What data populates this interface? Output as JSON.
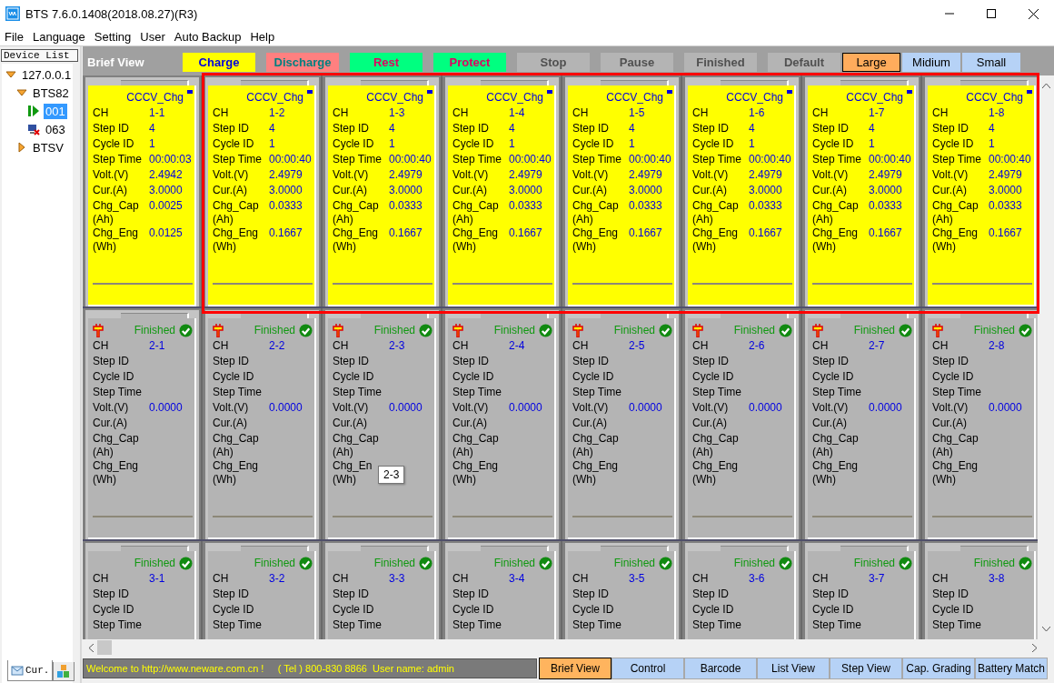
{
  "window": {
    "title": "BTS 7.6.0.1408(2018.08.27)(R3)"
  },
  "menu": [
    "File",
    "Language",
    "Setting",
    "User",
    "Auto Backup",
    "Help"
  ],
  "device_list": {
    "title": "Device List",
    "tree": [
      {
        "label": "127.0.0.1",
        "expanded": true,
        "children": [
          {
            "label": "BTS82",
            "expanded": true,
            "children": [
              {
                "label": "001",
                "kind": "running",
                "selected": true
              },
              {
                "label": "063",
                "kind": "offline",
                "selected": false
              }
            ]
          },
          {
            "label": "BTSV",
            "expanded": false
          }
        ]
      }
    ],
    "tabs": [
      {
        "label": "Cur.",
        "selected": true
      },
      {
        "selected": false
      }
    ]
  },
  "view_title": "Brief View",
  "legend": [
    {
      "label": "Charge",
      "kind": "charge",
      "color": "#ffff00"
    },
    {
      "label": "Discharge",
      "kind": "discharge",
      "color": "#ff8080"
    },
    {
      "label": "Rest",
      "kind": "rest",
      "color": "#00ff80"
    },
    {
      "label": "Protect",
      "kind": "protect",
      "color": "#00ff80"
    },
    {
      "label": "Stop",
      "kind": "idle",
      "color": "#b4b4b4"
    },
    {
      "label": "Pause",
      "kind": "idle",
      "color": "#b4b4b4"
    },
    {
      "label": "Finished",
      "kind": "idle",
      "color": "#b4b4b4"
    },
    {
      "label": "Default",
      "kind": "idle",
      "color": "#b4b4b4"
    }
  ],
  "sizes": [
    {
      "label": "Large",
      "selected": true
    },
    {
      "label": "Midium",
      "selected": false
    },
    {
      "label": "Small",
      "selected": false
    }
  ],
  "grid": [
    {
      "cards": [
        {
          "kind": "charge",
          "mode": "CCCV_Chg",
          "fields": [
            {
              "label": "CH",
              "value": "1-1"
            },
            {
              "label": "Step ID",
              "value": "4"
            },
            {
              "label": "Cycle ID",
              "value": "1"
            },
            {
              "label": "Step Time",
              "value": "00:00:03"
            },
            {
              "label": "Volt.(V)",
              "value": "2.4942"
            },
            {
              "label": "Cur.(A)",
              "value": "3.0000"
            },
            {
              "label": "Chg_Cap\n(Ah)",
              "value": "0.0025"
            },
            {
              "label": "Chg_Eng\n(Wh)",
              "value": "0.0125"
            }
          ]
        },
        {
          "kind": "charge",
          "mode": "CCCV_Chg",
          "fields": [
            {
              "label": "CH",
              "value": "1-2"
            },
            {
              "label": "Step ID",
              "value": "4"
            },
            {
              "label": "Cycle ID",
              "value": "1"
            },
            {
              "label": "Step Time",
              "value": "00:00:40"
            },
            {
              "label": "Volt.(V)",
              "value": "2.4979"
            },
            {
              "label": "Cur.(A)",
              "value": "3.0000"
            },
            {
              "label": "Chg_Cap\n(Ah)",
              "value": "0.0333"
            },
            {
              "label": "Chg_Eng\n(Wh)",
              "value": "0.1667"
            }
          ]
        },
        {
          "kind": "charge",
          "mode": "CCCV_Chg",
          "fields": [
            {
              "label": "CH",
              "value": "1-3"
            },
            {
              "label": "Step ID",
              "value": "4"
            },
            {
              "label": "Cycle ID",
              "value": "1"
            },
            {
              "label": "Step Time",
              "value": "00:00:40"
            },
            {
              "label": "Volt.(V)",
              "value": "2.4979"
            },
            {
              "label": "Cur.(A)",
              "value": "3.0000"
            },
            {
              "label": "Chg_Cap\n(Ah)",
              "value": "0.0333"
            },
            {
              "label": "Chg_Eng\n(Wh)",
              "value": "0.1667"
            }
          ]
        },
        {
          "kind": "charge",
          "mode": "CCCV_Chg",
          "fields": [
            {
              "label": "CH",
              "value": "1-4"
            },
            {
              "label": "Step ID",
              "value": "4"
            },
            {
              "label": "Cycle ID",
              "value": "1"
            },
            {
              "label": "Step Time",
              "value": "00:00:40"
            },
            {
              "label": "Volt.(V)",
              "value": "2.4979"
            },
            {
              "label": "Cur.(A)",
              "value": "3.0000"
            },
            {
              "label": "Chg_Cap\n(Ah)",
              "value": "0.0333"
            },
            {
              "label": "Chg_Eng\n(Wh)",
              "value": "0.1667"
            }
          ]
        },
        {
          "kind": "charge",
          "mode": "CCCV_Chg",
          "fields": [
            {
              "label": "CH",
              "value": "1-5"
            },
            {
              "label": "Step ID",
              "value": "4"
            },
            {
              "label": "Cycle ID",
              "value": "1"
            },
            {
              "label": "Step Time",
              "value": "00:00:40"
            },
            {
              "label": "Volt.(V)",
              "value": "2.4979"
            },
            {
              "label": "Cur.(A)",
              "value": "3.0000"
            },
            {
              "label": "Chg_Cap\n(Ah)",
              "value": "0.0333"
            },
            {
              "label": "Chg_Eng\n(Wh)",
              "value": "0.1667"
            }
          ]
        },
        {
          "kind": "charge",
          "mode": "CCCV_Chg",
          "fields": [
            {
              "label": "CH",
              "value": "1-6"
            },
            {
              "label": "Step ID",
              "value": "4"
            },
            {
              "label": "Cycle ID",
              "value": "1"
            },
            {
              "label": "Step Time",
              "value": "00:00:40"
            },
            {
              "label": "Volt.(V)",
              "value": "2.4979"
            },
            {
              "label": "Cur.(A)",
              "value": "3.0000"
            },
            {
              "label": "Chg_Cap\n(Ah)",
              "value": "0.0333"
            },
            {
              "label": "Chg_Eng\n(Wh)",
              "value": "0.1667"
            }
          ]
        },
        {
          "kind": "charge",
          "mode": "CCCV_Chg",
          "fields": [
            {
              "label": "CH",
              "value": "1-7"
            },
            {
              "label": "Step ID",
              "value": "4"
            },
            {
              "label": "Cycle ID",
              "value": "1"
            },
            {
              "label": "Step Time",
              "value": "00:00:40"
            },
            {
              "label": "Volt.(V)",
              "value": "2.4979"
            },
            {
              "label": "Cur.(A)",
              "value": "3.0000"
            },
            {
              "label": "Chg_Cap\n(Ah)",
              "value": "0.0333"
            },
            {
              "label": "Chg_Eng\n(Wh)",
              "value": "0.1667"
            }
          ]
        },
        {
          "kind": "charge",
          "mode": "CCCV_Chg",
          "fields": [
            {
              "label": "CH",
              "value": "1-8"
            },
            {
              "label": "Step ID",
              "value": "4"
            },
            {
              "label": "Cycle ID",
              "value": "1"
            },
            {
              "label": "Step Time",
              "value": "00:00:40"
            },
            {
              "label": "Volt.(V)",
              "value": "2.4979"
            },
            {
              "label": "Cur.(A)",
              "value": "3.0000"
            },
            {
              "label": "Chg_Cap\n(Ah)",
              "value": "0.0333"
            },
            {
              "label": "Chg_Eng\n(Wh)",
              "value": "0.1667"
            }
          ]
        }
      ]
    },
    {
      "cards": [
        {
          "kind": "finished",
          "status": "Finished",
          "plug": true,
          "fields": [
            {
              "label": "CH",
              "value": "2-1"
            },
            {
              "label": "Step ID"
            },
            {
              "label": "Cycle ID"
            },
            {
              "label": "Step Time"
            },
            {
              "label": "Volt.(V)",
              "value": "0.0000"
            },
            {
              "label": "Cur.(A)"
            },
            {
              "label": "Chg_Cap\n(Ah)"
            },
            {
              "label": "Chg_Eng\n(Wh)"
            }
          ]
        },
        {
          "kind": "finished",
          "status": "Finished",
          "plug": true,
          "fields": [
            {
              "label": "CH",
              "value": "2-2"
            },
            {
              "label": "Step ID"
            },
            {
              "label": "Cycle ID"
            },
            {
              "label": "Step Time"
            },
            {
              "label": "Volt.(V)",
              "value": "0.0000"
            },
            {
              "label": "Cur.(A)"
            },
            {
              "label": "Chg_Cap\n(Ah)"
            },
            {
              "label": "Chg_Eng\n(Wh)"
            }
          ]
        },
        {
          "kind": "finished",
          "status": "Finished",
          "plug": true,
          "fields": [
            {
              "label": "CH",
              "value": "2-3"
            },
            {
              "label": "Step ID"
            },
            {
              "label": "Cycle ID"
            },
            {
              "label": "Step Time"
            },
            {
              "label": "Volt.(V)",
              "value": "0.0000"
            },
            {
              "label": "Cur.(A)"
            },
            {
              "label": "Chg_Cap\n(Ah)"
            },
            {
              "label": "Chg_En\n(Wh)"
            }
          ]
        },
        {
          "kind": "finished",
          "status": "Finished",
          "plug": true,
          "fields": [
            {
              "label": "CH",
              "value": "2-4"
            },
            {
              "label": "Step ID"
            },
            {
              "label": "Cycle ID"
            },
            {
              "label": "Step Time"
            },
            {
              "label": "Volt.(V)",
              "value": "0.0000"
            },
            {
              "label": "Cur.(A)"
            },
            {
              "label": "Chg_Cap\n(Ah)"
            },
            {
              "label": "Chg_Eng\n(Wh)"
            }
          ]
        },
        {
          "kind": "finished",
          "status": "Finished",
          "plug": true,
          "fields": [
            {
              "label": "CH",
              "value": "2-5"
            },
            {
              "label": "Step ID"
            },
            {
              "label": "Cycle ID"
            },
            {
              "label": "Step Time"
            },
            {
              "label": "Volt.(V)",
              "value": "0.0000"
            },
            {
              "label": "Cur.(A)"
            },
            {
              "label": "Chg_Cap\n(Ah)"
            },
            {
              "label": "Chg_Eng\n(Wh)"
            }
          ]
        },
        {
          "kind": "finished",
          "status": "Finished",
          "plug": true,
          "fields": [
            {
              "label": "CH",
              "value": "2-6"
            },
            {
              "label": "Step ID"
            },
            {
              "label": "Cycle ID"
            },
            {
              "label": "Step Time"
            },
            {
              "label": "Volt.(V)",
              "value": "0.0000"
            },
            {
              "label": "Cur.(A)"
            },
            {
              "label": "Chg_Cap\n(Ah)"
            },
            {
              "label": "Chg_Eng\n(Wh)"
            }
          ]
        },
        {
          "kind": "finished",
          "status": "Finished",
          "plug": true,
          "fields": [
            {
              "label": "CH",
              "value": "2-7"
            },
            {
              "label": "Step ID"
            },
            {
              "label": "Cycle ID"
            },
            {
              "label": "Step Time"
            },
            {
              "label": "Volt.(V)",
              "value": "0.0000"
            },
            {
              "label": "Cur.(A)"
            },
            {
              "label": "Chg_Cap\n(Ah)"
            },
            {
              "label": "Chg_Eng\n(Wh)"
            }
          ]
        },
        {
          "kind": "finished",
          "status": "Finished",
          "plug": true,
          "fields": [
            {
              "label": "CH",
              "value": "2-8"
            },
            {
              "label": "Step ID"
            },
            {
              "label": "Cycle ID"
            },
            {
              "label": "Step Time"
            },
            {
              "label": "Volt.(V)",
              "value": "0.0000"
            },
            {
              "label": "Cur.(A)"
            },
            {
              "label": "Chg_Cap\n(Ah)"
            },
            {
              "label": "Chg_Eng\n(Wh)"
            }
          ]
        }
      ]
    },
    {
      "cards": [
        {
          "kind": "finished",
          "status": "Finished",
          "plug": false,
          "fields": [
            {
              "label": "CH",
              "value": "3-1"
            },
            {
              "label": "Step ID"
            },
            {
              "label": "Cycle ID"
            },
            {
              "label": "Step Time"
            }
          ]
        },
        {
          "kind": "finished",
          "status": "Finished",
          "plug": false,
          "fields": [
            {
              "label": "CH",
              "value": "3-2"
            },
            {
              "label": "Step ID"
            },
            {
              "label": "Cycle ID"
            },
            {
              "label": "Step Time"
            }
          ]
        },
        {
          "kind": "finished",
          "status": "Finished",
          "plug": false,
          "fields": [
            {
              "label": "CH",
              "value": "3-3"
            },
            {
              "label": "Step ID"
            },
            {
              "label": "Cycle ID"
            },
            {
              "label": "Step Time"
            }
          ]
        },
        {
          "kind": "finished",
          "status": "Finished",
          "plug": false,
          "fields": [
            {
              "label": "CH",
              "value": "3-4"
            },
            {
              "label": "Step ID"
            },
            {
              "label": "Cycle ID"
            },
            {
              "label": "Step Time"
            }
          ]
        },
        {
          "kind": "finished",
          "status": "Finished",
          "plug": false,
          "fields": [
            {
              "label": "CH",
              "value": "3-5"
            },
            {
              "label": "Step ID"
            },
            {
              "label": "Cycle ID"
            },
            {
              "label": "Step Time"
            }
          ]
        },
        {
          "kind": "finished",
          "status": "Finished",
          "plug": false,
          "fields": [
            {
              "label": "CH",
              "value": "3-6"
            },
            {
              "label": "Step ID"
            },
            {
              "label": "Cycle ID"
            },
            {
              "label": "Step Time"
            }
          ]
        },
        {
          "kind": "finished",
          "status": "Finished",
          "plug": false,
          "fields": [
            {
              "label": "CH",
              "value": "3-7"
            },
            {
              "label": "Step ID"
            },
            {
              "label": "Cycle ID"
            },
            {
              "label": "Step Time"
            }
          ]
        },
        {
          "kind": "finished",
          "status": "Finished",
          "plug": false,
          "fields": [
            {
              "label": "CH",
              "value": "3-8"
            },
            {
              "label": "Step ID"
            },
            {
              "label": "Cycle ID"
            },
            {
              "label": "Step Time"
            }
          ]
        }
      ]
    }
  ],
  "tooltip": {
    "text": "2-3"
  },
  "status_bar": {
    "message": "Welcome to http://www.neware.com.cn !     ( Tel ) 800-830 8866  User name: admin"
  },
  "view_tabs": [
    {
      "label": "Brief View",
      "selected": true
    },
    {
      "label": "Control",
      "selected": false
    },
    {
      "label": "Barcode",
      "selected": false
    },
    {
      "label": "List View",
      "selected": false
    },
    {
      "label": "Step View",
      "selected": false
    },
    {
      "label": "Cap. Grading",
      "selected": false
    },
    {
      "label": "Battery Match",
      "selected": false
    }
  ]
}
